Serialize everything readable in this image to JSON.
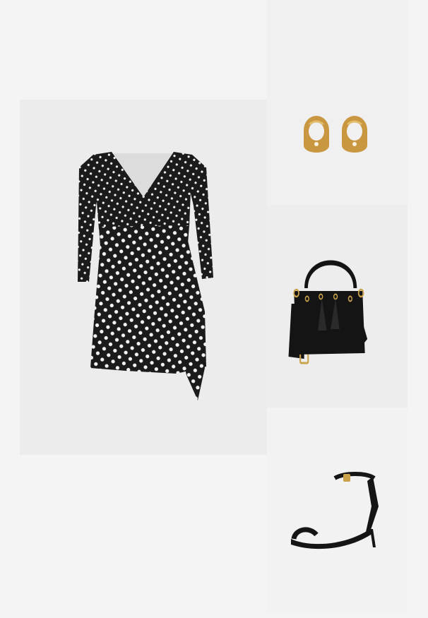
{
  "outfit": {
    "items": [
      {
        "id": "dress",
        "icon": "wrap-dress-image",
        "color": "#1b1b1b",
        "pattern_color": "#f4f4f4"
      },
      {
        "id": "earrings",
        "icon": "hoop-earrings-image",
        "color": "#c9973f"
      },
      {
        "id": "bag",
        "icon": "bucket-bag-image",
        "color": "#141414",
        "hardware_color": "#c9a24a"
      },
      {
        "id": "sandals",
        "icon": "heeled-sandal-image",
        "color": "#151515",
        "hardware_color": "#c9a24a"
      }
    ]
  }
}
